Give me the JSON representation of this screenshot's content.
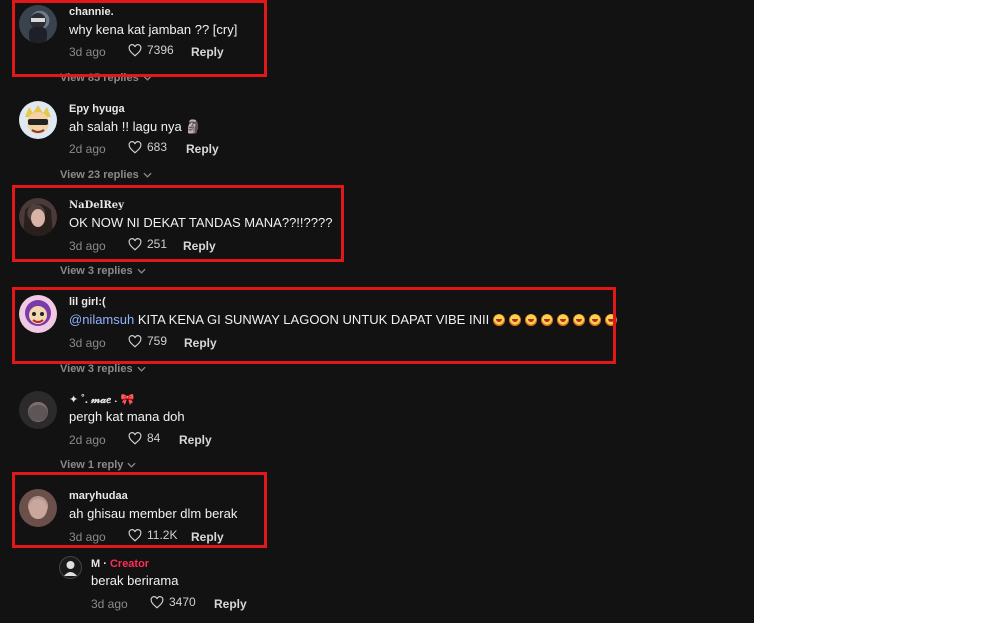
{
  "comments": [
    {
      "username": "channie.",
      "text": "why kena kat jamban ?? [cry]",
      "time": "3d ago",
      "likes": "7396",
      "reply": "Reply",
      "view_replies": "View 85 replies"
    },
    {
      "username": "Epy hyuga",
      "text": "ah salah !! lagu nya 🗿",
      "time": "2d ago",
      "likes": "683",
      "reply": "Reply",
      "view_replies": "View 23 replies"
    },
    {
      "username": "NaDelRey",
      "text": "OK NOW NI DEKAT TANDAS MANA??!!????",
      "time": "3d ago",
      "likes": "251",
      "reply": "Reply",
      "view_replies": "View 3 replies"
    },
    {
      "username": "lil girl:(",
      "mention": "@nilamsuh",
      "text": "KITA KENA GI SUNWAY LAGOON UNTUK DAPAT VIBE INII",
      "time": "3d ago",
      "likes": "759",
      "reply": "Reply",
      "view_replies": "View 3 replies"
    },
    {
      "username": "✦ ˚. 𝓂𝒶𝑒 ˖ 🎀",
      "text": "pergh kat mana doh",
      "time": "2d ago",
      "likes": "84",
      "reply": "Reply",
      "view_replies": "View 1 reply"
    },
    {
      "username": "maryhudaa",
      "text": "ah ghisau member dlm berak",
      "time": "3d ago",
      "likes": "11.2K",
      "reply": "Reply"
    }
  ],
  "nested_reply": {
    "username": "M",
    "separator": "·",
    "creator_label": "Creator",
    "text": "berak berirama",
    "time": "3d ago",
    "likes": "3470",
    "reply": "Reply"
  },
  "colors": {
    "highlight": "#e01818",
    "creator": "#fe2c55",
    "mention": "#8fb3ff",
    "background": "#121212"
  }
}
